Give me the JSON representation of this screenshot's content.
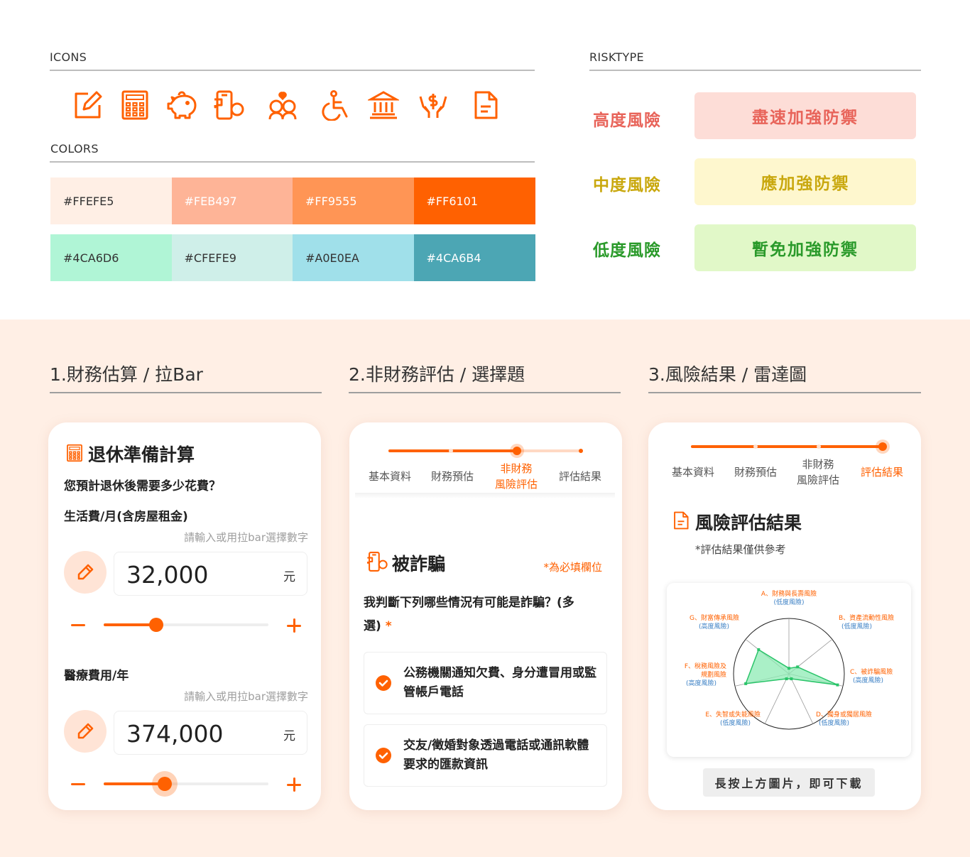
{
  "top": {
    "icons_label": "ICONS",
    "colors_label": "COLORS",
    "risktype_label": "RISKTYPE",
    "icons": [
      "edit-icon",
      "calculator-icon",
      "piggy-bank-icon",
      "phone-scam-icon",
      "family-icon",
      "accessibility-icon",
      "bank-icon",
      "money-hands-icon",
      "document-icon"
    ],
    "icon_color": "#FF6101",
    "colors_row1": [
      {
        "label": "#FFEFE5",
        "hex": "#FFEFE5",
        "text": "#333333"
      },
      {
        "label": "#FEB497",
        "hex": "#FEB497",
        "text": "#ffffff"
      },
      {
        "label": "#FF9555",
        "hex": "#FF9555",
        "text": "#ffffff"
      },
      {
        "label": "#FF6101",
        "hex": "#FF6101",
        "text": "#ffffff"
      }
    ],
    "colors_row2": [
      {
        "label": "#4CA6D6",
        "hex": "#B0F5D6",
        "text": "#333333"
      },
      {
        "label": "#CFEFE9",
        "hex": "#CFEFE9",
        "text": "#333333"
      },
      {
        "label": "#A0E0EA",
        "hex": "#A0E0EA",
        "text": "#333333"
      },
      {
        "label": "#4CA6B4",
        "hex": "#4CA6B4",
        "text": "#ffffff"
      }
    ],
    "risks": [
      {
        "label": "高度風險",
        "advice": "盡速加強防禦",
        "color": "#E8645A",
        "bg": "#FDDDD7"
      },
      {
        "label": "中度風險",
        "advice": "應加強防禦",
        "color": "#C9A80E",
        "bg": "#FEF7CE"
      },
      {
        "label": "低度風險",
        "advice": "暫免加強防禦",
        "color": "#2A9A2A",
        "bg": "#E1F8C8"
      }
    ]
  },
  "steps": {
    "step1": "1.財務估算 / 拉Bar",
    "step2": "2.非財務評估 / 選擇題",
    "step3": "3.風險結果 / 雷達圖"
  },
  "card1": {
    "title": "退休準備計算",
    "question": "您預計退休後需要多少花費？",
    "field1": {
      "label": "生活費/月(含房屋租金)",
      "hint": "請輸入或用拉bar選擇數字",
      "value": "32,000",
      "unit": "元",
      "slider_fraction": 0.32
    },
    "field2": {
      "label": "醫療費用/年",
      "hint": "請輸入或用拉bar選擇數字",
      "value": "374,000",
      "unit": "元",
      "slider_fraction": 0.37
    }
  },
  "tabs": [
    "基本資料",
    "財務預估",
    "非財務",
    "風險評估",
    "評估結果"
  ],
  "card2": {
    "title": "被詐騙",
    "required": "*為必填欄位",
    "question": "我判斷下列哪些情況有可能是詐騙？(多選)",
    "star": "*",
    "options": [
      "公務機關通知欠費、身分遭冒用或監管帳戶電話",
      "交友/徵婚對象透過電話或通訊軟體要求的匯款資訊"
    ]
  },
  "card3": {
    "title": "風險評估結果",
    "note": "*評估結果僅供參考",
    "download": "長按上方圖片，即可下載"
  },
  "chart_data": {
    "type": "radar",
    "categories": [
      "A、財務與長壽風險",
      "B、資產流動性風險",
      "C、被詐騙風險",
      "D、獨身或獨居風險",
      "E、失智或失能風險",
      "F、稅務風險及規劃風險",
      "G、財富傳承風險"
    ],
    "risk_levels": [
      "(低度風險)",
      "(低度風險)",
      "(高度風險)",
      "(低度風險)",
      "(低度風險)",
      "(高度風險)",
      "(高度風險)"
    ],
    "values": [
      0.1,
      0.2,
      0.9,
      0.1,
      0.1,
      0.8,
      0.7
    ],
    "fill": "#8EEBB4",
    "stroke": "#2BC46A"
  }
}
